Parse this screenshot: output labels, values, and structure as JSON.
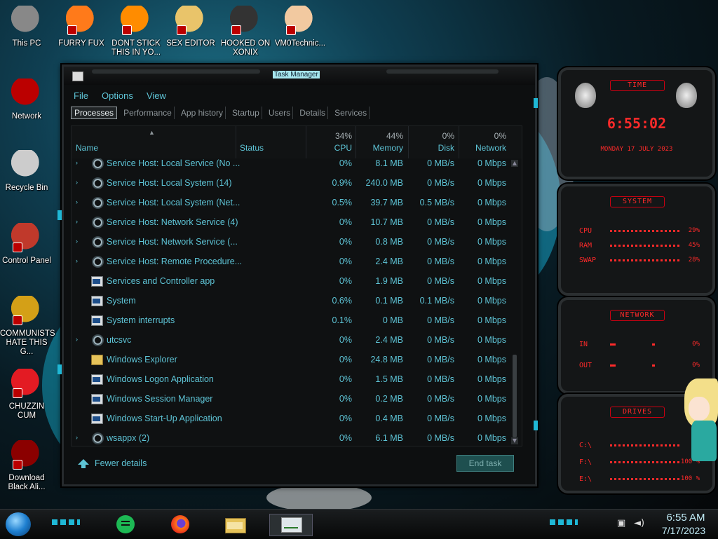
{
  "desktop": {
    "icons": [
      {
        "label": "This PC",
        "icon": "this-pc-icon"
      },
      {
        "label": "FURRY FUX",
        "icon": "firefox-icon"
      },
      {
        "label": "DONT STICK\nTHIS IN YO...",
        "icon": "vlc-icon"
      },
      {
        "label": "SEX EDITOR",
        "icon": "hxd-editor-icon"
      },
      {
        "label": "HOOKED ON\nXONIX",
        "icon": "xonix-game-icon"
      },
      {
        "label": "VM0Technic...",
        "icon": "doctor-icon"
      },
      {
        "label": "Network",
        "icon": "network-icon"
      },
      {
        "label": "Recycle Bin",
        "icon": "recycle-bin-icon"
      },
      {
        "label": "Control Panel",
        "icon": "control-panel-icon"
      },
      {
        "label": "COMMUNISTS\nHATE THIS G...",
        "icon": "money-bag-icon"
      },
      {
        "label": "CHUZZIN\nCUM",
        "icon": "chuzzle-icon"
      },
      {
        "label": "Download\nBlack Ali...",
        "icon": "alien-download-icon"
      }
    ]
  },
  "task_manager": {
    "title": "Task Manager",
    "menu": [
      "File",
      "Options",
      "View"
    ],
    "tabs": [
      "Processes",
      "Performance",
      "App history",
      "Startup",
      "Users",
      "Details",
      "Services"
    ],
    "active_tab": "Processes",
    "columns": {
      "name": "Name",
      "status": "Status",
      "cpu": {
        "label": "CPU",
        "pct": "34%"
      },
      "memory": {
        "label": "Memory",
        "pct": "44%"
      },
      "disk": {
        "label": "Disk",
        "pct": "0%"
      },
      "network": {
        "label": "Network",
        "pct": "0%"
      }
    },
    "processes": [
      {
        "name": "Service Host: Local Service (No ...",
        "icon": "gear",
        "expand": true,
        "cpu": "0%",
        "memory": "8.1 MB",
        "disk": "0 MB/s",
        "network": "0 Mbps"
      },
      {
        "name": "Service Host: Local System (14)",
        "icon": "gear",
        "expand": true,
        "cpu": "0.9%",
        "memory": "240.0 MB",
        "disk": "0 MB/s",
        "network": "0 Mbps"
      },
      {
        "name": "Service Host: Local System (Net...",
        "icon": "gear",
        "expand": true,
        "cpu": "0.5%",
        "memory": "39.7 MB",
        "disk": "0.5 MB/s",
        "network": "0 Mbps"
      },
      {
        "name": "Service Host: Network Service (4)",
        "icon": "gear",
        "expand": true,
        "cpu": "0%",
        "memory": "10.7 MB",
        "disk": "0 MB/s",
        "network": "0 Mbps"
      },
      {
        "name": "Service Host: Network Service (...",
        "icon": "gear",
        "expand": true,
        "cpu": "0%",
        "memory": "0.8 MB",
        "disk": "0 MB/s",
        "network": "0 Mbps"
      },
      {
        "name": "Service Host: Remote Procedure...",
        "icon": "gear",
        "expand": true,
        "cpu": "0%",
        "memory": "2.4 MB",
        "disk": "0 MB/s",
        "network": "0 Mbps"
      },
      {
        "name": "Services and Controller app",
        "icon": "win",
        "expand": false,
        "cpu": "0%",
        "memory": "1.9 MB",
        "disk": "0 MB/s",
        "network": "0 Mbps"
      },
      {
        "name": "System",
        "icon": "win",
        "expand": false,
        "cpu": "0.6%",
        "memory": "0.1 MB",
        "disk": "0.1 MB/s",
        "network": "0 Mbps"
      },
      {
        "name": "System interrupts",
        "icon": "win",
        "expand": false,
        "cpu": "0.1%",
        "memory": "0 MB",
        "disk": "0 MB/s",
        "network": "0 Mbps"
      },
      {
        "name": "utcsvc",
        "icon": "gear",
        "expand": true,
        "cpu": "0%",
        "memory": "2.4 MB",
        "disk": "0 MB/s",
        "network": "0 Mbps"
      },
      {
        "name": "Windows Explorer",
        "icon": "folder",
        "expand": false,
        "cpu": "0%",
        "memory": "24.8 MB",
        "disk": "0 MB/s",
        "network": "0 Mbps"
      },
      {
        "name": "Windows Logon Application",
        "icon": "win",
        "expand": false,
        "cpu": "0%",
        "memory": "1.5 MB",
        "disk": "0 MB/s",
        "network": "0 Mbps"
      },
      {
        "name": "Windows Session Manager",
        "icon": "win",
        "expand": false,
        "cpu": "0%",
        "memory": "0.2 MB",
        "disk": "0 MB/s",
        "network": "0 Mbps"
      },
      {
        "name": "Windows Start-Up Application",
        "icon": "win",
        "expand": false,
        "cpu": "0%",
        "memory": "0.4 MB",
        "disk": "0 MB/s",
        "network": "0 Mbps"
      },
      {
        "name": "wsappx (2)",
        "icon": "gear",
        "expand": true,
        "cpu": "0%",
        "memory": "6.1 MB",
        "disk": "0 MB/s",
        "network": "0 Mbps"
      }
    ],
    "footer": {
      "fewer_details": "Fewer details",
      "end_task": "End task"
    }
  },
  "gadgets": {
    "time": {
      "title": "TIME",
      "clock": "6:55:02",
      "date": "MONDAY 17 JULY 2023"
    },
    "system": {
      "title": "SYSTEM",
      "rows": [
        {
          "label": "CPU",
          "value": "29%"
        },
        {
          "label": "RAM",
          "value": "45%"
        },
        {
          "label": "SWAP",
          "value": "28%"
        }
      ]
    },
    "network": {
      "title": "NETWORK",
      "rows": [
        {
          "label": "IN",
          "value": "0%"
        },
        {
          "label": "OUT",
          "value": "0%"
        }
      ]
    },
    "drives": {
      "title": "DRIVES",
      "rows": [
        {
          "label": "C:\\",
          "value": ""
        },
        {
          "label": "F:\\",
          "value": "100 %"
        },
        {
          "label": "E:\\",
          "value": "100 %"
        }
      ]
    }
  },
  "taskbar": {
    "apps": [
      "spotify-icon",
      "firefox-icon",
      "file-explorer-icon",
      "task-manager-icon"
    ],
    "time": "6:55 AM",
    "date": "7/17/2023"
  },
  "colors": {
    "accent": "#5ec4d6",
    "gadget_red": "#ff2a2a",
    "wallpaper_cyan": "#1fb5d6"
  }
}
